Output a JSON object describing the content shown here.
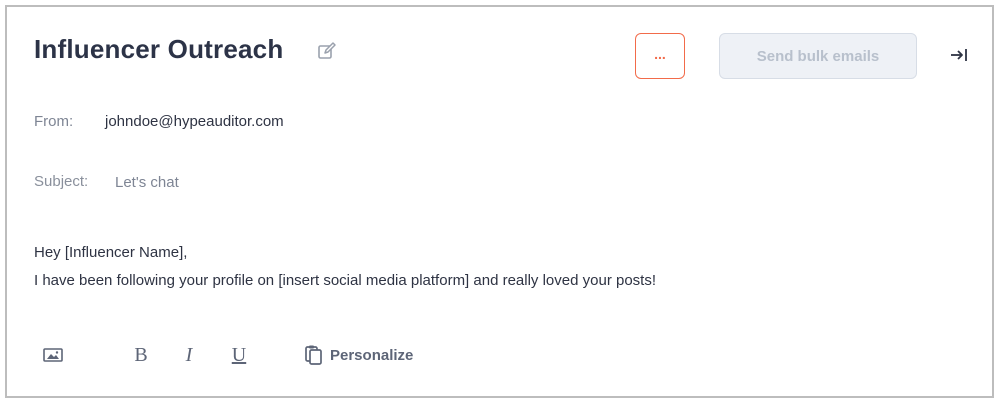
{
  "header": {
    "title": "Influencer Outreach",
    "more_label": "...",
    "send_label": "Send bulk emails"
  },
  "email": {
    "from_label": "From:",
    "from_value": "johndoe@hypeauditor.com",
    "subject_label": "Subject:",
    "subject_value": "Let's chat",
    "greeting": "Hey [Influencer Name],",
    "body": "I have been following your profile on [insert social media platform] and really loved your posts!"
  },
  "toolbar": {
    "bold_label": "B",
    "italic_label": "I",
    "underline_label": "U",
    "personalize_label": "Personalize"
  },
  "icons": {
    "edit": "edit-icon",
    "collapse": "collapse-panel-icon",
    "image": "image-icon",
    "personalize": "copy-icon"
  },
  "colors": {
    "accent": "#f26b4a",
    "title": "#2c3347",
    "muted": "#7e8594",
    "disabled_bg": "#eef1f6"
  }
}
